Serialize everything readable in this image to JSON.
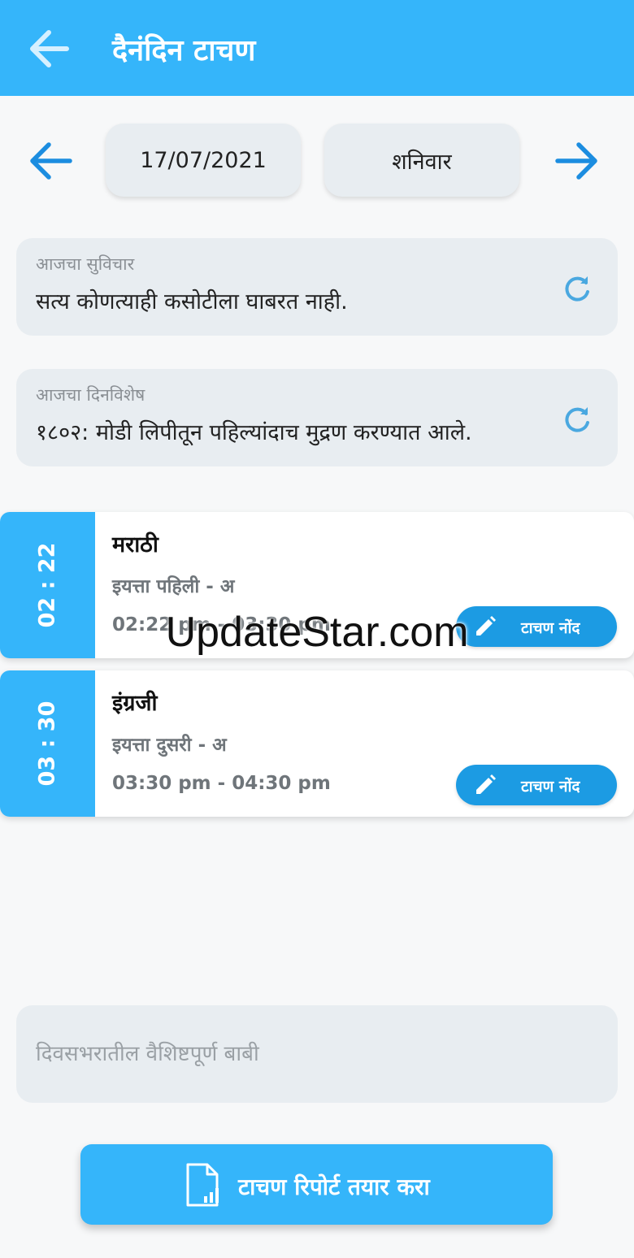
{
  "app_bar": {
    "title": "दैनंदिन टाचण",
    "back_icon": "arrow-left-icon",
    "background": "#35b5fa"
  },
  "date_nav": {
    "date": "17/07/2021",
    "day": "शनिवार",
    "prev_icon": "arrow-left-icon",
    "next_icon": "arrow-right-icon",
    "arrow_color": "#1c8de0"
  },
  "thought": {
    "label": "आजचा सुविचार",
    "text": "सत्य कोणत्याही कसोटीला घाबरत नाही.",
    "refresh_icon": "refresh-icon"
  },
  "day_event": {
    "label": "आजचा दिनविशेष",
    "text": "१८०२: मोडी लिपीतून पहिल्यांदाच मुद्रण करण्यात आले.",
    "refresh_icon": "refresh-icon"
  },
  "periods": [
    {
      "side_time": "02 : 22",
      "subject": "मराठी",
      "class": "इयत्ता पहिली - अ",
      "time_range": "02:22 pm - 03:30 pm",
      "button_label": "टाचण नोंद",
      "button_icon": "pencil-icon"
    },
    {
      "side_time": "03 : 30",
      "subject": "इंग्रजी",
      "class": "इयत्ता दुसरी - अ",
      "time_range": "03:30 pm - 04:30 pm",
      "button_label": "टाचण नोंद",
      "button_icon": "pencil-icon"
    }
  ],
  "highlights": {
    "placeholder": "दिवसभरातील वैशिष्टपूर्ण बाबी",
    "value": ""
  },
  "report_button": {
    "label": "टाचण रिपोर्ट तयार करा",
    "icon": "report-document-icon"
  },
  "watermark": "UpdateStar.com"
}
